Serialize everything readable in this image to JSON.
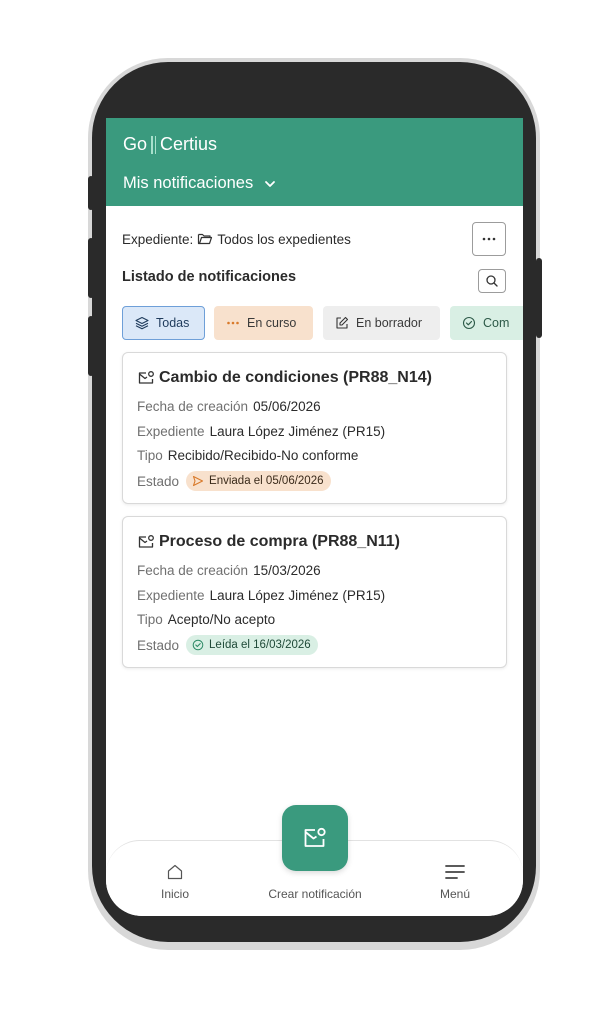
{
  "header": {
    "logo_left": "Go",
    "logo_right": "Certius",
    "title": "Mis notificaciones"
  },
  "expediente": {
    "label": "Expediente:",
    "value": "Todos los expedientes"
  },
  "list": {
    "title": "Listado de notificaciones"
  },
  "filters": [
    {
      "label": "Todas",
      "icon": "layers-icon"
    },
    {
      "label": "En curso",
      "icon": "dots-icon"
    },
    {
      "label": "En borrador",
      "icon": "edit-icon"
    },
    {
      "label": "Completadas",
      "icon": "check-circle-icon",
      "visible_text": "Com"
    }
  ],
  "cards": [
    {
      "title": "Cambio de condiciones (PR88_N14)",
      "fecha_label": "Fecha de creación",
      "fecha": "05/06/2026",
      "expediente_label": "Expediente",
      "expediente": "Laura López Jiménez (PR15)",
      "tipo_label": "Tipo",
      "tipo": "Recibido/Recibido-No conforme",
      "estado_label": "Estado",
      "estado": "Enviada el 05/06/2026"
    },
    {
      "title": "Proceso de compra (PR88_N11)",
      "fecha_label": "Fecha de creación",
      "fecha": "15/03/2026",
      "expediente_label": "Expediente",
      "expediente": "Laura López Jiménez (PR15)",
      "tipo_label": "Tipo",
      "tipo": "Acepto/No acepto",
      "estado_label": "Estado",
      "estado": "Leída el 16/03/2026"
    }
  ],
  "nav": {
    "inicio": "Inicio",
    "crear": "Crear notificación",
    "menu": "Menú"
  },
  "colors": {
    "primary": "#3a9a7e",
    "sent_badge": "#f8e1cd",
    "read_badge": "#d9efe4"
  }
}
